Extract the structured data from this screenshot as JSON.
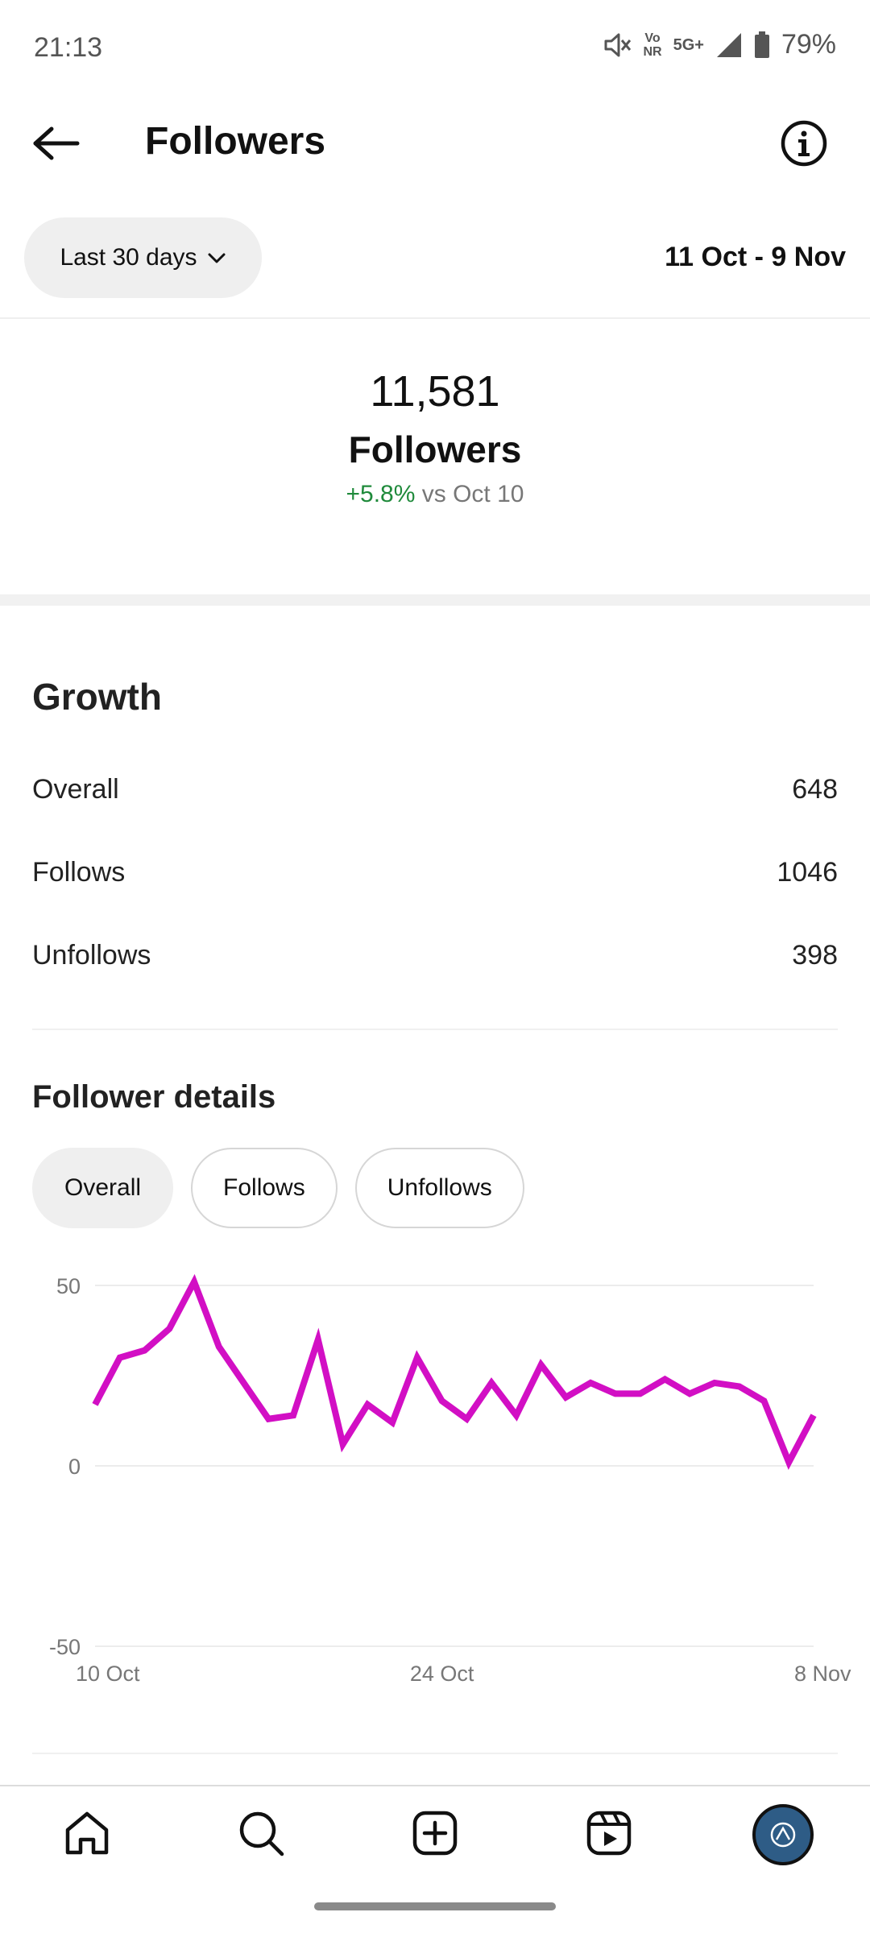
{
  "status_bar": {
    "time": "21:13",
    "net_top": "Vo",
    "net_bottom": "NR",
    "signal_5g": "5G+",
    "battery": "79%"
  },
  "header": {
    "title": "Followers"
  },
  "filter": {
    "range_label": "Last 30 days",
    "date_range": "11 Oct - 9 Nov"
  },
  "summary": {
    "count": "11,581",
    "label": "Followers",
    "change": "+5.8%",
    "change_suffix": "vs Oct 10"
  },
  "growth": {
    "title": "Growth",
    "rows": [
      {
        "label": "Overall",
        "value": "648"
      },
      {
        "label": "Follows",
        "value": "1046"
      },
      {
        "label": "Unfollows",
        "value": "398"
      }
    ]
  },
  "details": {
    "title": "Follower details",
    "tabs": [
      "Overall",
      "Follows",
      "Unfollows"
    ],
    "active_tab": "Overall"
  },
  "chart_data": {
    "type": "line",
    "x_ticks": [
      "10 Oct",
      "24 Oct",
      "8 Nov"
    ],
    "ylim": [
      -50,
      50
    ],
    "y_ticks": [
      "50",
      "0",
      "-50"
    ],
    "grid": true,
    "line_color": "#d20fc4",
    "x": [
      "10 Oct",
      "11 Oct",
      "12 Oct",
      "13 Oct",
      "14 Oct",
      "15 Oct",
      "16 Oct",
      "17 Oct",
      "18 Oct",
      "19 Oct",
      "20 Oct",
      "21 Oct",
      "22 Oct",
      "23 Oct",
      "24 Oct",
      "25 Oct",
      "26 Oct",
      "27 Oct",
      "28 Oct",
      "29 Oct",
      "30 Oct",
      "31 Oct",
      "1 Nov",
      "2 Nov",
      "3 Nov",
      "4 Nov",
      "5 Nov",
      "6 Nov",
      "7 Nov",
      "8 Nov",
      "9 Nov"
    ],
    "values": [
      17,
      30,
      32,
      38,
      51,
      33,
      23,
      13,
      14,
      35,
      6,
      17,
      12,
      30,
      18,
      13,
      23,
      14,
      28,
      19,
      23,
      20,
      20,
      24,
      20,
      23,
      22,
      18,
      1,
      14
    ]
  },
  "colors": {
    "accent_positive": "#1f8a3b",
    "avatar_bg": "#2e5c86"
  },
  "bottom_nav": [
    "home-icon",
    "search-icon",
    "create-icon",
    "reels-icon",
    "profile-avatar"
  ]
}
